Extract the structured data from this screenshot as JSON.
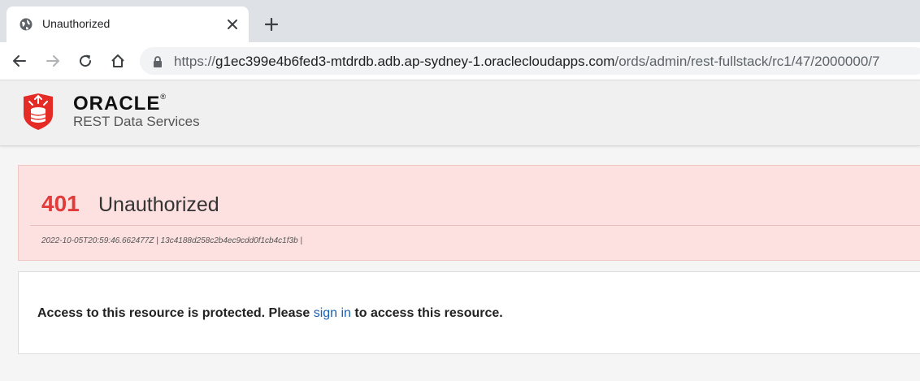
{
  "browser": {
    "tab_title": "Unauthorized",
    "url_scheme": "https://",
    "url_host": "g1ec399e4b6fed3-mtdrdb.adb.ap-sydney-1.oraclecloudapps.com",
    "url_path": "/ords/admin/rest-fullstack/rc1/47/2000000/7"
  },
  "header": {
    "brand": "ORACLE",
    "brand_mark": "®",
    "product": "REST Data Services"
  },
  "error": {
    "code": "401",
    "title": "Unauthorized",
    "meta": "2022-10-05T20:59:46.662477Z | 13c4188d258c2b4ec9cdd0f1cb4c1f3b |"
  },
  "message": {
    "before": "Access to this resource is protected. Please ",
    "link": "sign in",
    "after": " to access this resource."
  },
  "colors": {
    "error_red": "#e23b3b",
    "error_bg": "#fde1e1",
    "link_blue": "#1a5fb4",
    "logo_red": "#e52b26"
  }
}
